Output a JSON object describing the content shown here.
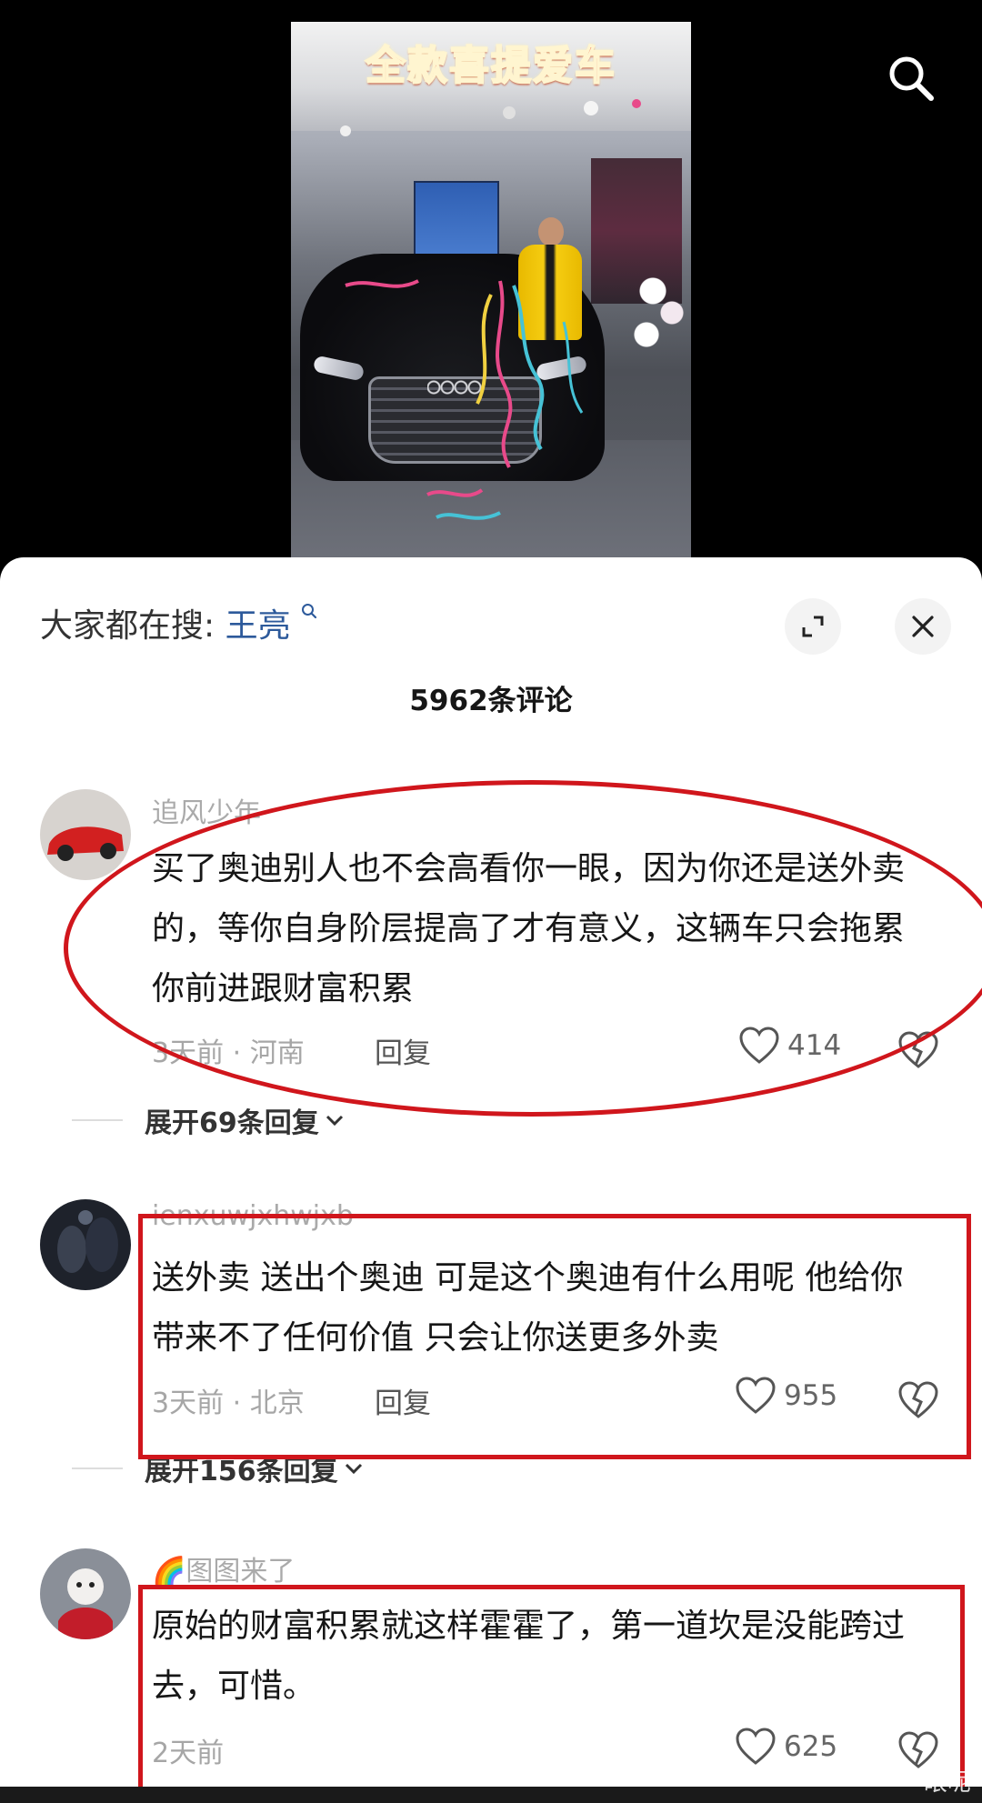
{
  "video": {
    "title": "全款喜提爱车"
  },
  "search": {
    "icon": "search-icon"
  },
  "sheet": {
    "trend_label": "大家都在搜:",
    "trend_keyword": "王亮",
    "comment_count": "5962条评论"
  },
  "comments": [
    {
      "username": "追风少年",
      "text": "买了奥迪别人也不会高看你一眼，因为你还是送外卖的，等你自身阶层提高了才有意义，这辆车只会拖累你前进跟财富积累",
      "meta": "3天前 · 河南",
      "reply": "回复",
      "likes": "414",
      "expand": "展开69条回复"
    },
    {
      "username": "ienxuwjxhwjxb",
      "text": "送外卖 送出个奥迪 可是这个奥迪有什么用呢 他给你带来不了任何价值 只会让你送更多外卖",
      "meta": "3天前 · 北京",
      "reply": "回复",
      "likes": "955",
      "expand": "展开156条回复"
    },
    {
      "username": "🌈图图来了",
      "text": "原始的财富积累就这样霍霍了，第一道坎是没能跨过去，可惜。",
      "meta": "2天前",
      "likes": "625"
    }
  ],
  "watermark": "一眼呢",
  "colors": {
    "accent_link": "#2d5a9b",
    "annotation_red": "#d0161c"
  }
}
